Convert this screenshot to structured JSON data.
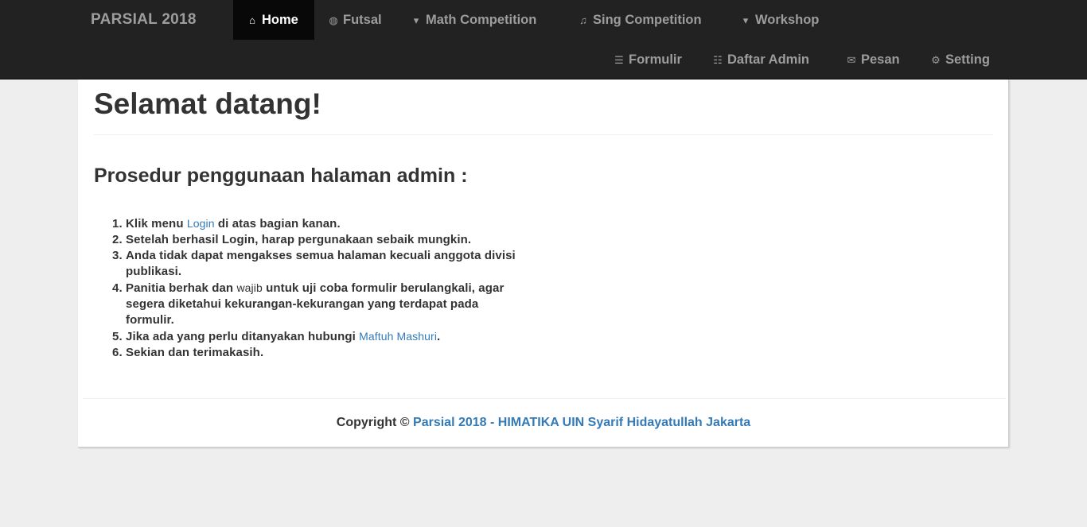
{
  "navbar": {
    "brand": "PARSIAL 2018",
    "items_row1": [
      {
        "icon": "home-icon",
        "glyph": "⌂",
        "label": "Home",
        "active": true
      },
      {
        "icon": "globe-icon",
        "glyph": "◍",
        "label": "Futsal"
      },
      {
        "icon": "graduation-cap-icon",
        "glyph": "▾",
        "label": "Math Competition"
      },
      {
        "icon": "music-icon",
        "glyph": "♫",
        "label": "Sing Competition"
      },
      {
        "icon": "graduation-cap-icon",
        "glyph": "▾",
        "label": "Workshop"
      }
    ],
    "items_row2": [
      {
        "icon": "tasks-icon",
        "glyph": "☰",
        "label": "Formulir"
      },
      {
        "icon": "list-icon",
        "glyph": "☷",
        "label": "Daftar Admin"
      },
      {
        "icon": "envelope-icon",
        "glyph": "✉",
        "label": "Pesan"
      },
      {
        "icon": "cog-icon",
        "glyph": "⚙",
        "label": "Setting"
      }
    ]
  },
  "main": {
    "title": "Selamat datang!",
    "section_title": "Prosedur penggunaan halaman admin :",
    "steps": [
      {
        "pre": "Klik menu ",
        "link": "Login",
        "post": " di atas bagian kanan."
      },
      {
        "pre": "Setelah berhasil Login, harap pergunakaan sebaik mungkin."
      },
      {
        "pre": "Anda tidak dapat mengakses semua halaman kecuali anggota divisi publikasi."
      },
      {
        "pre": "Panitia berhak dan ",
        "norm": "wajib",
        "post": " untuk uji coba formulir berulangkali, agar segera diketahui kekurangan-kekurangan yang terdapat pada formulir."
      },
      {
        "pre": "Jika ada yang perlu ditanyakan hubungi ",
        "link": "Maftuh Mashuri",
        "post": "."
      },
      {
        "pre": "Sekian dan terimakasih."
      }
    ]
  },
  "footer": {
    "prefix": "Copyright © ",
    "link": "Parsial 2018 - HIMATIKA UIN Syarif Hidayatullah Jakarta"
  }
}
